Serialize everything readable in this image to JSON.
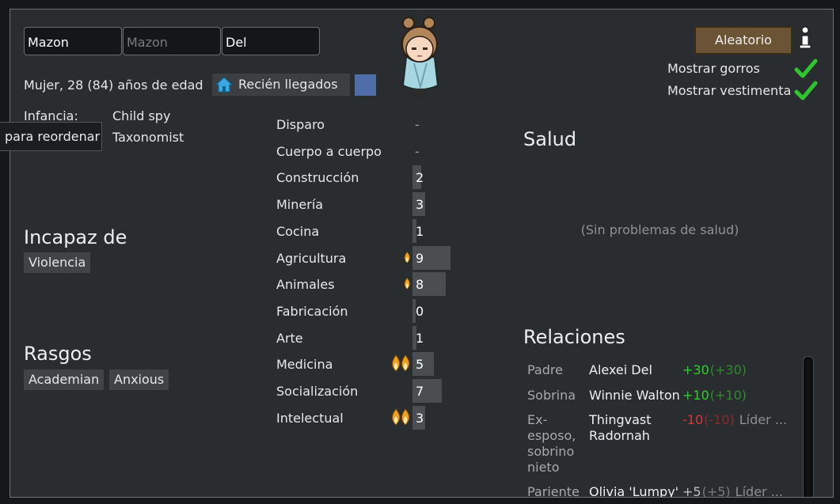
{
  "name": {
    "first": "Mazon",
    "nick_placeholder": "Mazon",
    "last": "Del"
  },
  "info": {
    "gender_age": "Mujer, 28 (84) años de edad",
    "faction": "Recién llegados",
    "faction_color": "#4f6ea8"
  },
  "backstory": {
    "childhood_label": "Infancia:",
    "childhood_value": "Child spy",
    "adulthood_value": "Taxonomist",
    "tooltip": "para reordenar"
  },
  "incapable": {
    "title": "Incapaz de",
    "items": [
      "Violencia"
    ]
  },
  "traits": {
    "title": "Rasgos",
    "items": [
      "Academian",
      "Anxious"
    ]
  },
  "skills": [
    {
      "name": "Disparo",
      "value": "-",
      "passion": 0,
      "level": 0
    },
    {
      "name": "Cuerpo a cuerpo",
      "value": "-",
      "passion": 0,
      "level": 0
    },
    {
      "name": "Construcción",
      "value": "2",
      "passion": 0,
      "level": 2
    },
    {
      "name": "Minería",
      "value": "3",
      "passion": 0,
      "level": 3
    },
    {
      "name": "Cocina",
      "value": "1",
      "passion": 0,
      "level": 1
    },
    {
      "name": "Agricultura",
      "value": "9",
      "passion": 1,
      "level": 9
    },
    {
      "name": "Animales",
      "value": "8",
      "passion": 1,
      "level": 8
    },
    {
      "name": "Fabricación",
      "value": "0",
      "passion": 0,
      "level": 0
    },
    {
      "name": "Arte",
      "value": "1",
      "passion": 0,
      "level": 1
    },
    {
      "name": "Medicina",
      "value": "5",
      "passion": 2,
      "level": 5
    },
    {
      "name": "Socialización",
      "value": "7",
      "passion": 0,
      "level": 7
    },
    {
      "name": "Intelectual",
      "value": "3",
      "passion": 2,
      "level": 3
    }
  ],
  "controls": {
    "random_button": "Aleatorio",
    "info_icon": "info-icon",
    "show_hats": "Mostrar gorros",
    "show_apparel": "Mostrar vestimenta"
  },
  "health": {
    "title": "Salud",
    "empty": "(Sin problemas de salud)"
  },
  "relations": {
    "title": "Relaciones",
    "rows": [
      {
        "label": "Padre",
        "name": "Alexei Del",
        "opinion": "+30",
        "opinion2": "(+30)",
        "extra": "",
        "tone": "pos"
      },
      {
        "label": "Sobrina",
        "name": "Winnie Walton",
        "opinion": "+10",
        "opinion2": "(+10)",
        "extra": "",
        "tone": "pos"
      },
      {
        "label": "Ex-esposo, sobrino nieto",
        "name": "Thingvast Radornah",
        "opinion": "-10",
        "opinion2": "(-10)",
        "extra": "Líder ...",
        "tone": "neg"
      },
      {
        "label": "Pariente",
        "name": "Olivia 'Lumpy' David",
        "opinion": "+5",
        "opinion2": "(+5)",
        "extra": "Líder ...",
        "tone": "neu"
      }
    ]
  },
  "colors": {
    "panel_bg": "#2a2d30",
    "flame": "#f0a020",
    "check": "#2fc52f"
  }
}
